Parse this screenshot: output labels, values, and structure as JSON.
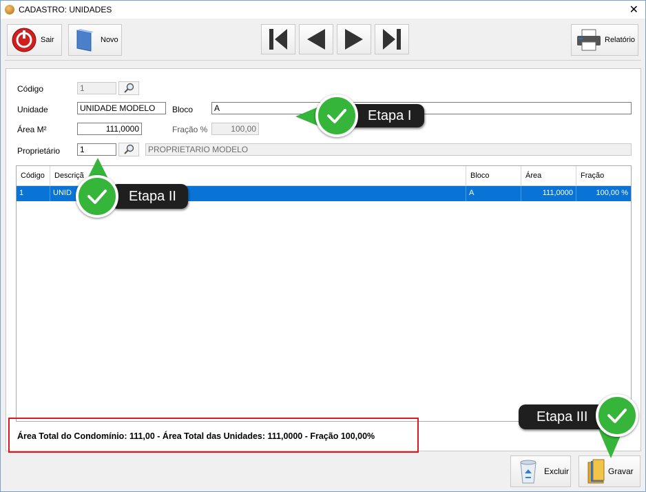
{
  "window": {
    "title": "CADASTRO: UNIDADES",
    "close": "✕"
  },
  "toolbar": {
    "sair": "Sair",
    "novo": "Novo",
    "relatorio": "Relatório"
  },
  "form": {
    "codigo_label": "Código",
    "codigo_value": "1",
    "unidade_label": "Unidade",
    "unidade_value": "UNIDADE MODELO",
    "bloco_label": "Bloco",
    "bloco_value": "A",
    "area_label": "Área M²",
    "area_value": "111,0000",
    "fracao_label": "Fração %",
    "fracao_value": "100,00",
    "proprietario_label": "Proprietário",
    "proprietario_codigo": "1",
    "proprietario_nome": "PROPRIETARIO MODELO"
  },
  "grid": {
    "headers": [
      "Código",
      "Descriçã",
      "Bloco",
      "Área",
      "Fração"
    ],
    "row": {
      "codigo": "1",
      "descricao": "UNID",
      "bloco": "A",
      "area": "111,0000",
      "fracao": "100,00 %"
    }
  },
  "totals": "Área Total do Condomínio: 111,00 - Área Total das Unidades: 111,0000 - Fração 100,00%",
  "bottom": {
    "excluir": "Excluir",
    "gravar": "Gravar"
  },
  "callouts": {
    "etapa1": "Etapa I",
    "etapa2": "Etapa II",
    "etapa3": "Etapa III"
  },
  "colors": {
    "accent": "#0a74d6",
    "highlight_border": "#e0161b",
    "badge": "#35b53a"
  }
}
